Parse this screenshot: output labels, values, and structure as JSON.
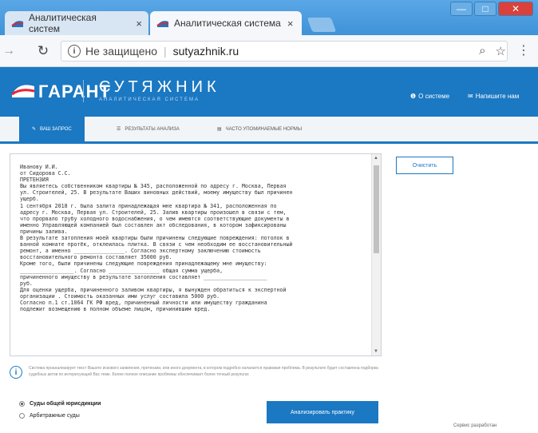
{
  "browser": {
    "tabs": [
      {
        "label": "Аналитическая систем"
      },
      {
        "label": "Аналитическая система"
      }
    ],
    "tab_close": "×",
    "security_label": "Не защищено",
    "url": "sutyazhnik.ru",
    "window_buttons": {
      "minimize": "—",
      "maximize": "□",
      "close": "✕"
    }
  },
  "header": {
    "logo_text": "ГАРАНТ",
    "brand_title": "СУТЯЖНИК",
    "brand_subtitle": "АНАЛИТИЧЕСКАЯ СИСТЕМА",
    "link_about": "О системе",
    "link_write": "Напишите нам"
  },
  "page_tabs": [
    {
      "label": "ВАШ ЗАПРОС"
    },
    {
      "label": "РЕЗУЛЬТАТЫ АНАЛИЗА"
    },
    {
      "label": "ЧАСТО УПОМИНАЕМЫЕ НОРМЫ"
    }
  ],
  "request_text": "Иванову И.И.\nот Сидорова С.С.\nПРЕТЕНЗИЯ\nВы являетесь собственником квартиры № 345, расположенной по адресу г. Москва, Первая\nул. Строителей, 25. В результате Ваших виновных действий, моему имуществу был причинен\nущерб.\n1 сентября 2018 г. была залита принадлежащая мне квартира № 341, расположенная по\nадресу г. Москва, Первая ул. Строителей, 25. Залив квартиры произошел в связи с тем,\nчто прорвало трубу холодного водоснабжения, о чем имеются соответствующие документы в\nименно Управляющей компанией был составлен акт обследования, в котором зафиксированы\nпричины залива.\nВ результате затопления моей квартиры были причинены следующие повреждения: потолок в\nванной комнате протёк, отклеилась плитка. В связи с чем необходим ее восстановительный\nремонт, а именно ________________. Согласно экспертному заключению стоимость\nвосстановительного ремонта составляет 35000 руб.\nКроме того, были причинены следующие повреждения принадлежащему мне имуществу:\n_________________. Согласно ________________ общая сумма ущерба,\nпричиненного имуществу в результате затопления составляет ____________________\nруб.\nДля оценки ущерба, причиненного заливом квартиры, я вынужден обратиться к экспертной\nорганизации . Стоимость оказанных ими услуг составила 5000 руб.\nСогласно п.1 ст.1064 ГК РФ вред, причиненный личности или имуществу гражданина\nподлежит возмещению в полном объеме лицом, причинившим вред.",
  "clear_button": "Очистить",
  "info_text": "Система проанализирует текст Вашего искового заявления, претензии, или иного документа, в котором подробно излагается правовая проблема. В результате будет составлена подборка судебных актов по интересующей Вас теме. Более полное описание проблемы обеспечивает более точный результат.",
  "radio_options": [
    {
      "label": "Суды общей юрисдикции",
      "selected": true
    },
    {
      "label": "Арбитражные суды",
      "selected": false
    }
  ],
  "analyze_button": "Анализировать практику",
  "dev_service": "Сервис разработан"
}
